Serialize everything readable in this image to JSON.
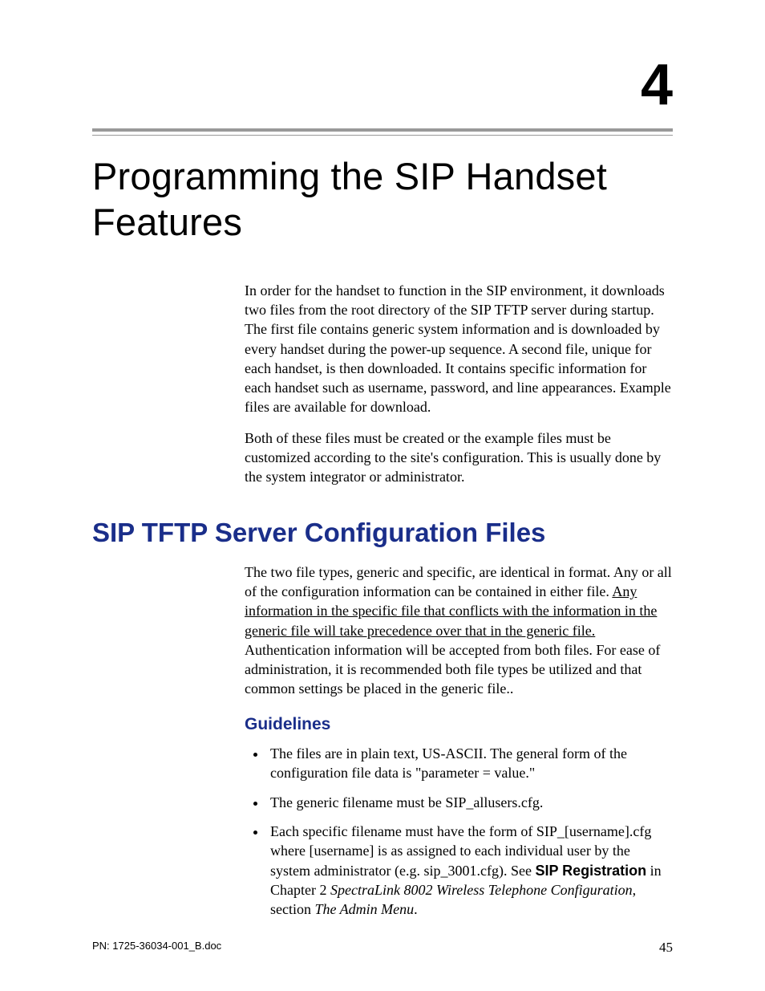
{
  "chapter": {
    "number": "4",
    "title": "Programming the SIP Handset Features"
  },
  "intro": {
    "p1": "In order for the handset to function in the SIP environment, it downloads two files from the root directory of the SIP TFTP server during startup. The first file contains generic system information and is downloaded by every handset during the power-up sequence. A second file, unique for each handset, is then downloaded. It contains specific information for each handset such as username, password, and line appearances. Example files are available for download.",
    "p2": "Both of these files must be created or the example files must be customized according to the site's configuration. This is usually done by the system integrator or administrator."
  },
  "section": {
    "title": "SIP TFTP Server Configuration Files",
    "p1a": "The two file types, generic and specific, are identical in format. Any or all of the configuration information can be contained in either file. ",
    "p1_underline": "Any information in the specific file that conflicts with the information in the generic file will take precedence over that in the generic file.",
    "p1b": " Authentication information will be accepted from both files. For ease of administration, it is recommended both file types be utilized and that common settings be placed in the generic file..",
    "sub": "Guidelines",
    "bullets": {
      "b1": "The files are in plain text, US-ASCII. The general form of the configuration file data is \"parameter = value.\"",
      "b2": "The generic filename must be SIP_allusers.cfg.",
      "b3_a": "Each specific filename must have the form of SIP_[username].cfg where [username] is as assigned to each individual user by the system administrator (e.g. sip_3001.cfg). See ",
      "b3_bold": "SIP Registration",
      "b3_b": " in Chapter 2 ",
      "b3_italic1": "SpectraLink 8002 Wireless Telephone Configuration",
      "b3_c": ", section ",
      "b3_italic2": "The Admin Menu",
      "b3_d": "."
    }
  },
  "footer": {
    "left": "PN: 1725-36034-001_B.doc",
    "right": "45"
  }
}
